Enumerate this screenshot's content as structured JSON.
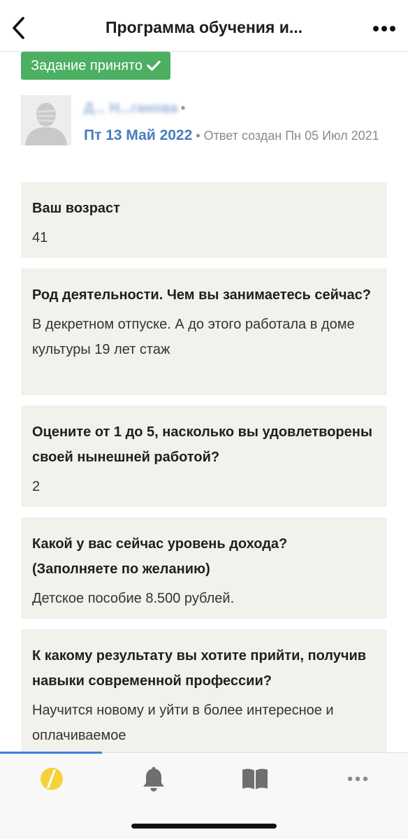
{
  "header": {
    "title": "Программа обучения и..."
  },
  "badge": {
    "label": "Задание принято"
  },
  "author": {
    "name": "Д... Н...ганова",
    "separator": "•",
    "date": "Пт 13 Май 2022",
    "created_label": "• Ответ создан Пн 05 Июл 2021"
  },
  "cards": [
    {
      "question": "Ваш возраст",
      "answer": "41"
    },
    {
      "question": "Род деятельности. Чем вы занимаетесь сейчас?",
      "answer": "В декретном отпуске. А до этого работала в доме культуры 19 лет стаж"
    },
    {
      "question": "Оцените от 1 до 5, насколько вы удовлетворены своей нынешней работой?",
      "answer": "2"
    },
    {
      "question": "Какой у вас сейчас уровень дохода? (Заполняете по желанию)",
      "answer": "Детское пособие 8.500 рублей."
    },
    {
      "question": "К какому результату вы хотите прийти, получив навыки современной профессии?",
      "answer": "Научится новому и уйти в более интересное и оплачиваемое"
    }
  ],
  "tabbar": {
    "progress": 0.25,
    "items": [
      "home-icon",
      "bell-icon",
      "book-icon",
      "more-icon"
    ]
  },
  "colors": {
    "badge_green": "#4caf62",
    "link_blue": "#4a7bbf",
    "card_bg": "#f2f1ec",
    "logo_yellow": "#f4d23a"
  }
}
